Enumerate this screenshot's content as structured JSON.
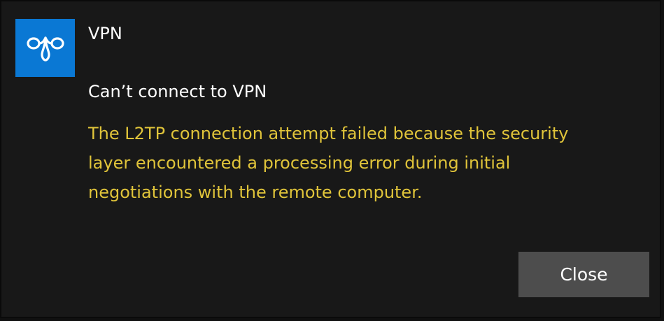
{
  "app": {
    "name": "VPN",
    "icon": "vpn-icon",
    "icon_background": "#0a78d4"
  },
  "notification": {
    "title": "Can’t connect to VPN",
    "message": "The L2TP connection attempt failed because the security\nlayer encountered a processing error during initial\nnegotiations with the remote computer.",
    "message_color": "#e0c43a"
  },
  "actions": {
    "close_label": "Close"
  }
}
